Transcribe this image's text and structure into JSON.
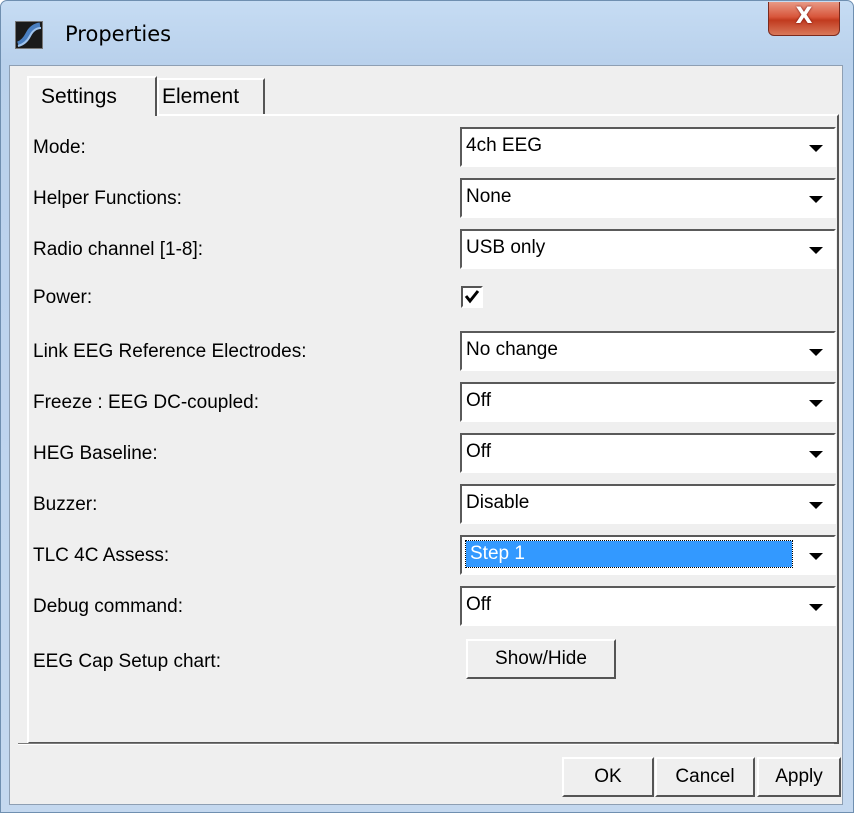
{
  "window": {
    "title": "Properties",
    "close_label": "X"
  },
  "tabs": {
    "settings": "Settings",
    "element": "Element"
  },
  "rows": {
    "mode": {
      "label": "Mode:",
      "value": "4ch EEG"
    },
    "helper": {
      "label": "Helper Functions:",
      "value": "None"
    },
    "radio": {
      "label": "Radio channel [1-8]:",
      "value": "USB only"
    },
    "power": {
      "label": "Power:",
      "checked": true
    },
    "link": {
      "label": "Link EEG Reference Electrodes:",
      "value": "No change"
    },
    "freeze": {
      "label": "Freeze : EEG DC-coupled:",
      "value": "Off"
    },
    "heg": {
      "label": "HEG Baseline:",
      "value": "Off"
    },
    "buzzer": {
      "label": "Buzzer:",
      "value": "Disable"
    },
    "tlc": {
      "label": "TLC 4C Assess:",
      "value": "Step 1"
    },
    "debug": {
      "label": "Debug command:",
      "value": "Off"
    },
    "eegcap": {
      "label": "EEG Cap Setup chart:",
      "button": "Show/Hide"
    }
  },
  "footer": {
    "ok": "OK",
    "cancel": "Cancel",
    "apply": "Apply"
  },
  "colors": {
    "selection": "#3399ff",
    "dialog_bg": "#efefef",
    "close_button": "#c13a1f"
  },
  "icons": {
    "app": "waveform-app-icon",
    "dropdown": "chevron-down-icon",
    "check": "checkmark-icon"
  }
}
